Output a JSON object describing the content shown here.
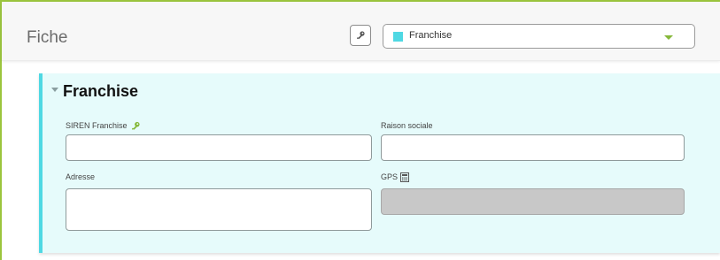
{
  "header": {
    "title": "Fiche",
    "type_select": {
      "selected": "Franchise",
      "swatch_color": "#4fd8e3"
    },
    "key_button_icon": "key-icon"
  },
  "section": {
    "title": "Franchise",
    "accent_color": "#4fd8e3",
    "fields": {
      "siren": {
        "label": "SIREN Franchise",
        "value": "",
        "icon": "key-icon"
      },
      "raison_sociale": {
        "label": "Raison sociale",
        "value": ""
      },
      "adresse": {
        "label": "Adresse",
        "value": ""
      },
      "gps": {
        "label": "GPS",
        "value": "",
        "icon": "calculator-icon"
      }
    }
  },
  "colors": {
    "frame_border": "#9bc53d",
    "key_icon": "#86b83a"
  }
}
